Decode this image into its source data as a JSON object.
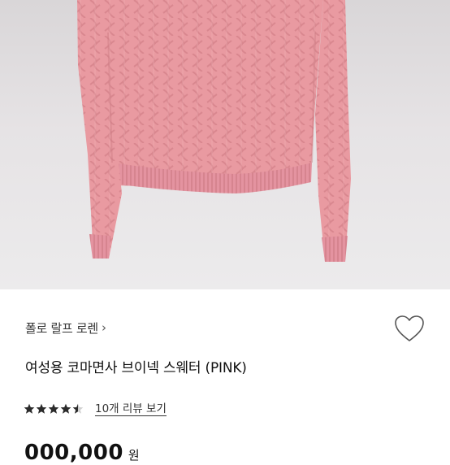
{
  "product": {
    "brand": "폴로 랄프 로렌",
    "brand_chevron": "›",
    "title": "여성용 코마면사 브이넥 스웨터 (PINK)",
    "rating": 4.5,
    "rating_max": 5,
    "review_link": "10개 리뷰 보기",
    "price": "000,000",
    "currency": "원"
  },
  "colors": {
    "sweater": "#e99aa1",
    "sweater_shadow": "#d9868e",
    "background": "#e4e1e3",
    "star": "#2b2b2b",
    "text": "#111111"
  },
  "icons": {
    "wishlist": "heart-outline-icon",
    "star": "star-icon"
  }
}
